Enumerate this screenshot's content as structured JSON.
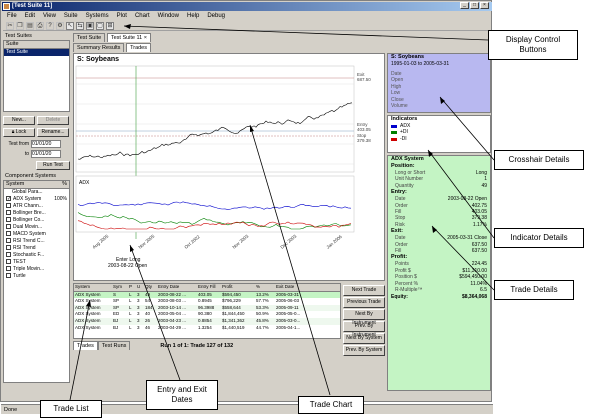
{
  "window": {
    "title": "[Test Suite 11]",
    "menu": [
      "File",
      "Edit",
      "View",
      "Suite",
      "Systems",
      "Plot",
      "Chart",
      "Window",
      "Help",
      "Debug"
    ],
    "status_text": "Done"
  },
  "left_panel": {
    "test_suites_header": "Test Suites",
    "suite_col": "Suite",
    "suite_item": "Test Suite",
    "new_label": "New...",
    "delete_label": "Delete",
    "lock_label": "Lock",
    "rename_label": "Rename...",
    "test_from_label": "Test from",
    "test_from_value": "01/01/20",
    "to_label": "to",
    "to_value": "01/01/20",
    "run_test_label": "Run Test",
    "component_systems_header": "Component Systems",
    "system_col": "System",
    "pct_col": "%",
    "global_params": "Global Para...",
    "systems": [
      {
        "name": "ADX System",
        "pct": "100%",
        "checked": true
      },
      {
        "name": "ATR Chann...",
        "pct": "",
        "checked": false
      },
      {
        "name": "Bollinger Bre...",
        "pct": "",
        "checked": false
      },
      {
        "name": "Bollinger Co...",
        "pct": "",
        "checked": false
      },
      {
        "name": "Dual Movin...",
        "pct": "",
        "checked": false
      },
      {
        "name": "MACD System",
        "pct": "",
        "checked": false
      },
      {
        "name": "RSI Trend C...",
        "pct": "",
        "checked": false
      },
      {
        "name": "RSI Trend",
        "pct": "",
        "checked": false
      },
      {
        "name": "Stochastic F...",
        "pct": "",
        "checked": false
      },
      {
        "name": "TEST",
        "pct": "",
        "checked": false
      },
      {
        "name": "Triple Movin...",
        "pct": "",
        "checked": false
      },
      {
        "name": "Turtle",
        "pct": "",
        "checked": false
      }
    ]
  },
  "main": {
    "doc_tabs": [
      "Test Suite",
      "Test Suite 11"
    ],
    "view_tabs": [
      "Summary Results",
      "Trades"
    ],
    "chart_title": "S: Soybeans",
    "price_labels": {
      "exit": "Exit",
      "exit_val": "687.50",
      "entry": "Entry",
      "entry_val": "403.05",
      "stop": "Stop",
      "stop_val": "379.38"
    },
    "indicator_label": "ADX",
    "x_ticks": [
      "Aug 2005",
      "Nov 2005",
      "Oct 2002",
      "Nov 2003",
      "Dec 2003",
      "Jan 2006"
    ],
    "entry_annotation": "Enter Long",
    "entry_date": "2003-08-22 Open",
    "bottom_tabs": [
      "Trades",
      "Test Runs"
    ],
    "run_status": "Run 1 of 1: Trade 127 of 132"
  },
  "trade_list": {
    "columns": [
      "System",
      "Sym",
      "P",
      "U",
      "Qty",
      "Entry Date",
      "Entry Fill",
      "Profit",
      "%",
      "Exit Date"
    ],
    "rows": [
      [
        "ADX System",
        "S",
        "L",
        "3",
        "49",
        "2003-08-22 ...",
        "403.05",
        "$594,450",
        "13.2%",
        "2005-03-31"
      ],
      [
        "ADX System",
        "SP",
        "L",
        "3",
        "54",
        "2003-08-03 ...",
        "0.8945",
        "$796,229",
        "57.7%",
        "2005-06-03"
      ],
      [
        "ADX System",
        "SP",
        "L",
        "3",
        "184",
        "2003-10-14 ...",
        "96.3988",
        "$558,644",
        "53.3%",
        "2005-09-11"
      ],
      [
        "ADX System",
        "ED",
        "L",
        "3",
        "40",
        "2003-05-04 ...",
        "90.380",
        "$1,844,450",
        "50.9%",
        "2005-05-0..."
      ],
      [
        "ADX System",
        "BJ",
        "L",
        "3",
        "26",
        "2003-04-23 ...",
        "0.8854",
        "$1,341,362",
        "45.8%",
        "2005-03-0..."
      ],
      [
        "ADX System",
        "BJ",
        "L",
        "3",
        "46",
        "2003-04-29 ...",
        "1.3254",
        "$1,440,519",
        "44.7%",
        "2005-04-1..."
      ]
    ]
  },
  "nav_buttons": [
    "Next Trade",
    "Previous Trade",
    "Next By Instrument",
    "Prev. By Instrument",
    "Next By System",
    "Prev. By System"
  ],
  "crosshair": {
    "title": "S: Soybeans",
    "range": "1995-01-03 to 2005-03-31",
    "fields": [
      "Date",
      "Open",
      "High",
      "Low",
      "Close",
      "Volume"
    ]
  },
  "indicators": {
    "title": "Indicators",
    "items": [
      {
        "name": "ADX",
        "color": "#0000cc"
      },
      {
        "name": "+DI",
        "color": "#008000"
      },
      {
        "name": "-DI",
        "color": "#cc0000"
      }
    ]
  },
  "trade_details": {
    "title": "ADX System",
    "position_title": "Position:",
    "position": [
      [
        "Long or Short",
        "Long"
      ],
      [
        "Unit Number",
        "1"
      ],
      [
        "Quantity",
        "49"
      ]
    ],
    "entry_title": "Entry:",
    "entry": [
      [
        "Date",
        "2003-08-22 Open"
      ],
      [
        "Order",
        "402.75"
      ],
      [
        "Fill",
        "403.05"
      ],
      [
        "Stop",
        "379.38"
      ],
      [
        "Risk",
        "1.17%"
      ]
    ],
    "exit_title": "Exit:",
    "exit": [
      [
        "Date",
        "2005-03-31 Close"
      ],
      [
        "Order",
        "637.50"
      ],
      [
        "Fill",
        "637.50"
      ]
    ],
    "profit_title": "Profit:",
    "profit": [
      [
        "Points",
        "224.45"
      ],
      [
        "Profit $",
        "$11,310.00"
      ],
      [
        "Position $",
        "$594,450.00"
      ],
      [
        "Percent %",
        "11.04%"
      ],
      [
        "R-Multiple™",
        "6.5"
      ]
    ],
    "equity_title": "Equity:",
    "equity_value": "$8,364,068"
  },
  "callouts": {
    "display_control": "Display Control Buttons",
    "crosshair": "Crosshair Details",
    "indicator": "Indicator Details",
    "trade_details": "Trade Details",
    "trade_list": "Trade List",
    "entry_exit": "Entry and Exit Dates",
    "trade_chart": "Trade Chart"
  },
  "colors": {
    "crosshair_bg": "#b8b8f0",
    "indicator_bg": "#ffffff",
    "trade_details_bg": "#c4f4c4",
    "title_bar": "#0a246a"
  }
}
